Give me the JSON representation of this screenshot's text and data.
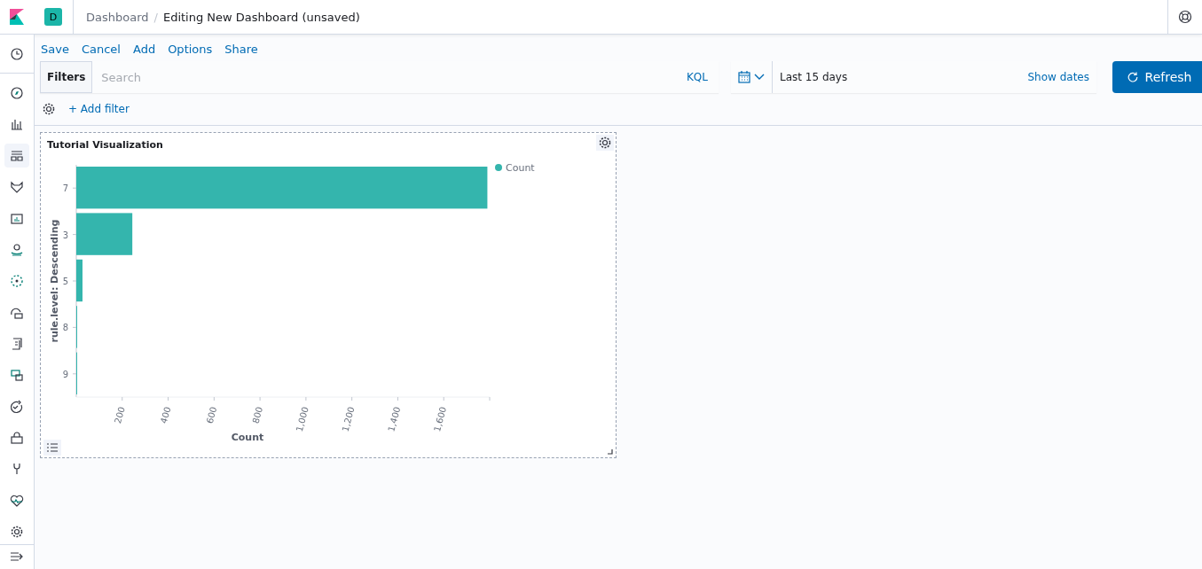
{
  "sidebar": {
    "items": [
      {
        "selected": false
      },
      {
        "selected": false
      },
      {
        "selected": false
      },
      {
        "selected": true
      },
      {
        "selected": false
      },
      {
        "selected": false
      },
      {
        "selected": false
      },
      {
        "selected": false
      },
      {
        "selected": false
      },
      {
        "selected": false
      },
      {
        "selected": false
      },
      {
        "selected": false
      },
      {
        "selected": false
      },
      {
        "selected": false
      },
      {
        "selected": false
      },
      {
        "selected": false
      }
    ]
  },
  "header": {
    "space_avatar": "D",
    "separator": "/",
    "breadcrumbs": [
      {
        "label": "Dashboard",
        "selected": false
      },
      {
        "label": "Editing New Dashboard (unsaved)",
        "selected": true
      }
    ]
  },
  "toolbar": {
    "actions": [
      "Save",
      "Cancel",
      "Add",
      "Options",
      "Share"
    ]
  },
  "query_bar": {
    "filters_label": "Filters",
    "search": {
      "placeholder": "Search"
    },
    "language": "KQL",
    "time_range": "Last 15 days",
    "show_dates": "Show dates",
    "refresh": "Refresh",
    "add_filter": "+ Add filter"
  },
  "panel": {
    "title": "Tutorial Visualization",
    "chart_data": {
      "type": "bar",
      "orientation": "horizontal",
      "xlabel": "Count",
      "ylabel": "rule.level: Descending",
      "categories": [
        "7",
        "3",
        "5",
        "8",
        "9"
      ],
      "series": [
        {
          "name": "Count",
          "color": "#34b5ad",
          "values": [
            1790,
            244,
            27,
            3,
            2
          ]
        }
      ],
      "xlim": [
        0,
        1800
      ],
      "xticks": [
        {
          "value": 200,
          "label": "200"
        },
        {
          "value": 400,
          "label": "400"
        },
        {
          "value": 600,
          "label": "600"
        },
        {
          "value": 800,
          "label": "800"
        },
        {
          "value": 1000,
          "label": "1,000"
        },
        {
          "value": 1200,
          "label": "1,200"
        },
        {
          "value": 1400,
          "label": "1,400"
        },
        {
          "value": 1600,
          "label": "1,600"
        }
      ]
    }
  }
}
